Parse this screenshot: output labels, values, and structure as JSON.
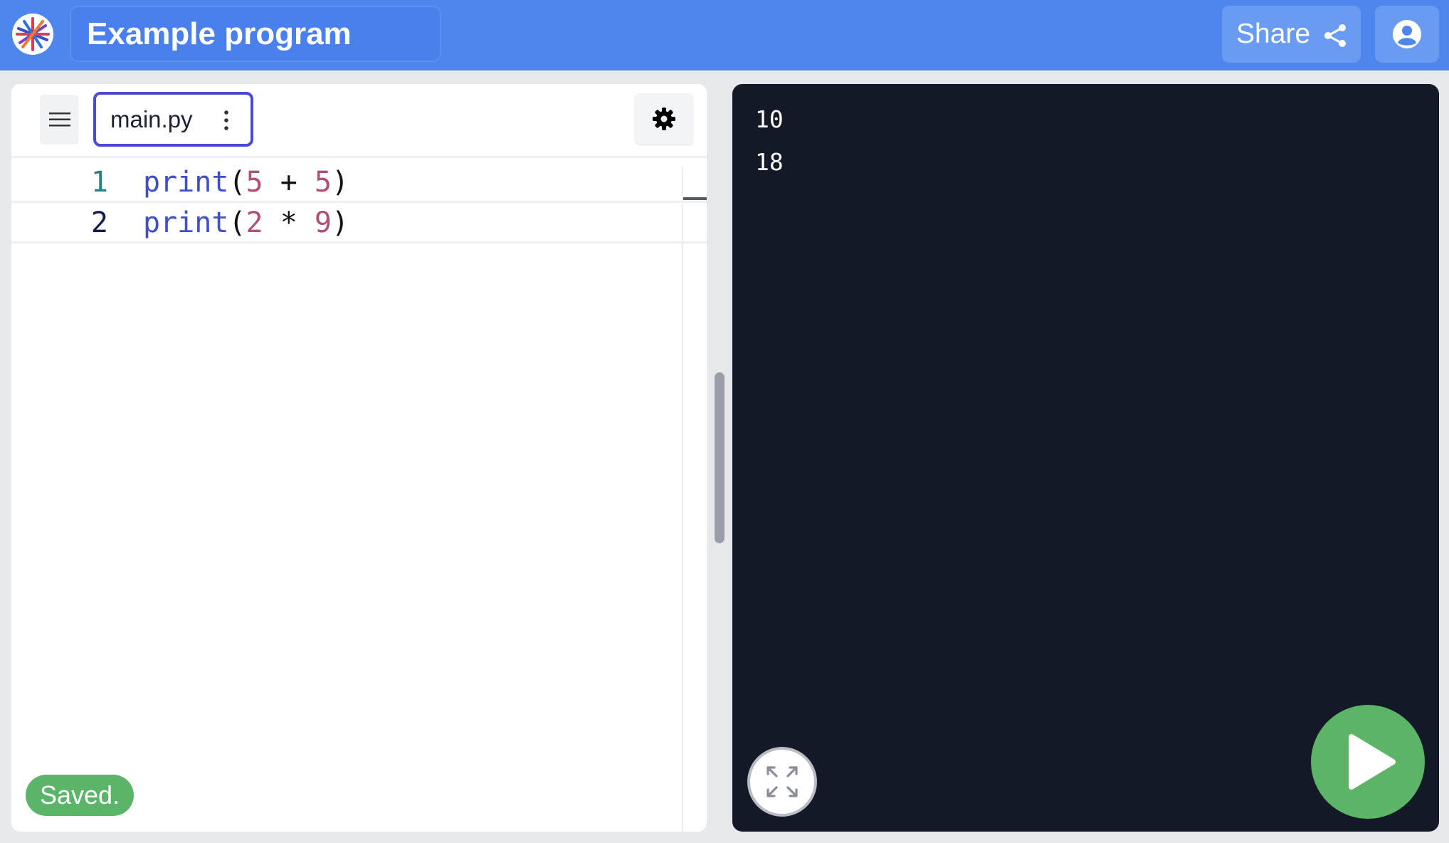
{
  "header": {
    "title": "Example program",
    "share_label": "Share"
  },
  "editor": {
    "tab_name": "main.py",
    "lines": [
      {
        "number": "1",
        "fn": "print",
        "open": "(",
        "a": "5",
        "op": " + ",
        "b": "5",
        "close": ")"
      },
      {
        "number": "2",
        "fn": "print",
        "open": "(",
        "a": "2",
        "op": " * ",
        "b": "9",
        "close": ")"
      }
    ],
    "status": "Saved."
  },
  "output": {
    "lines": [
      "10",
      "18"
    ]
  },
  "colors": {
    "header_bg": "#4f86ee",
    "accent_tab_border": "#4a4ad4",
    "code_function": "#3f4fc8",
    "code_number": "#b14f78",
    "line_number_inactive": "#2f7f86",
    "line_number_active": "#111a4a",
    "saved_green": "#5ab568",
    "run_green": "#5cb467",
    "output_bg": "#131927"
  },
  "icons": {
    "logo": "starburst-logo-icon",
    "share": "share-icon",
    "profile": "user-circle-icon",
    "menu": "hamburger-menu-icon",
    "tab_menu": "kebab-menu-icon",
    "settings": "gear-icon",
    "expand": "expand-arrows-icon",
    "run": "play-icon"
  }
}
